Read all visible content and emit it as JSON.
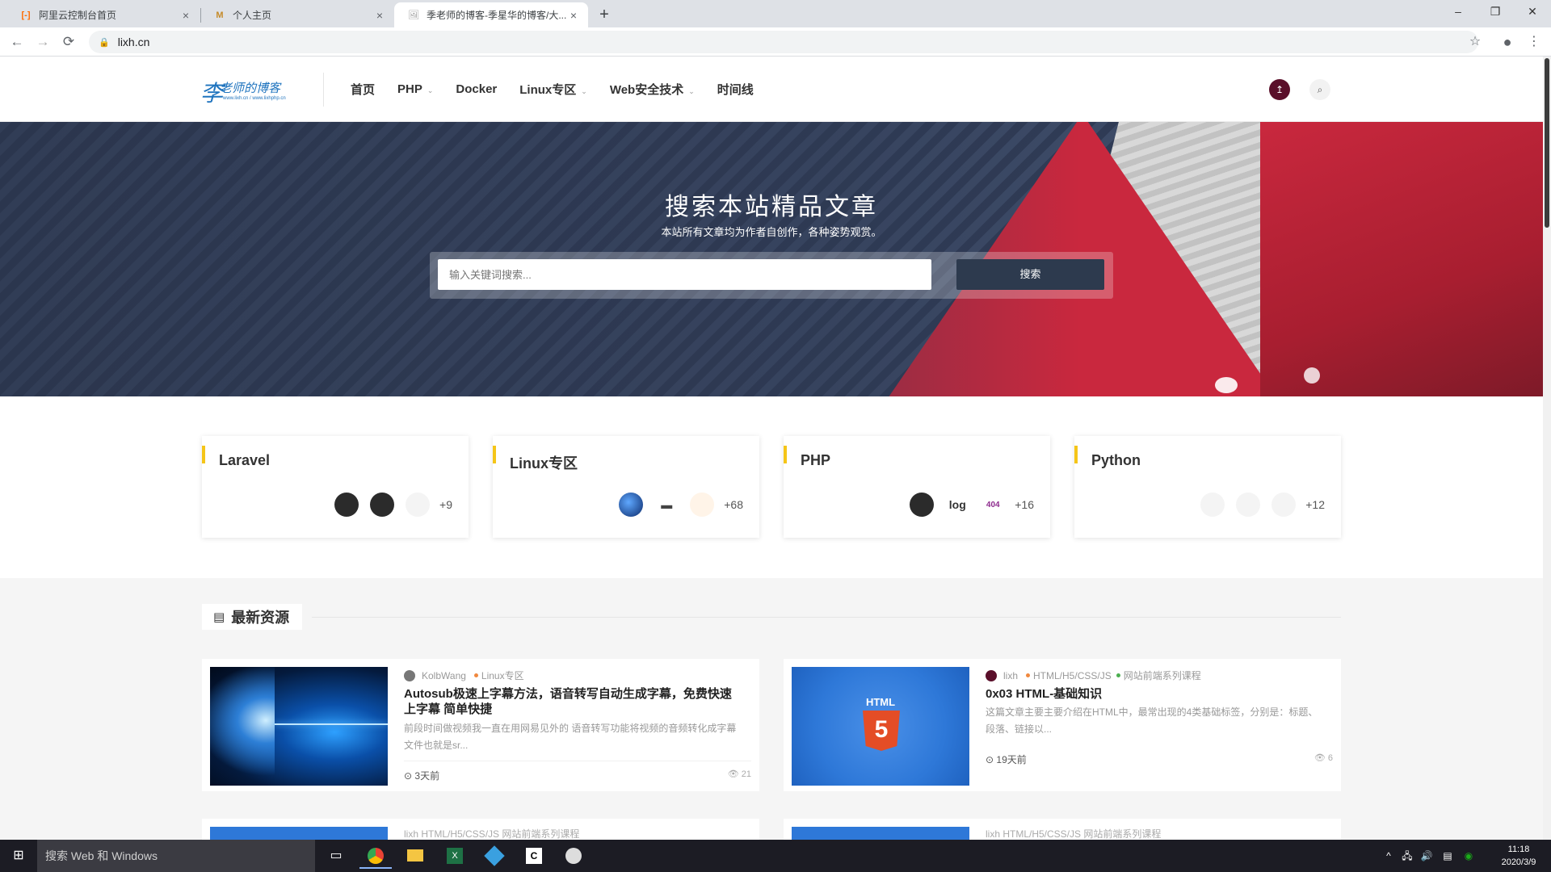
{
  "browser": {
    "tabs": [
      {
        "title": "阿里云控制台首页",
        "close": "×",
        "icon": "aliyun-icon"
      },
      {
        "title": "个人主页",
        "close": "×",
        "icon": "home-icon"
      },
      {
        "title": "季老师的博客-季星华的博客/大...",
        "close": "×",
        "icon": "blog-icon"
      }
    ],
    "new_tab": "+",
    "url": "lixh.cn",
    "window_controls": {
      "minimize": "–",
      "restore": "❐",
      "close": "✕"
    },
    "icons": {
      "back": "←",
      "forward": "→",
      "reload": "⟳",
      "lock": "🔒",
      "star": "☆",
      "account": "●",
      "menu": "⋮"
    }
  },
  "site": {
    "logo": {
      "mark": "李",
      "text": "老师的博客",
      "sub": "www.lixh.cn / www.lixhphp.cn"
    },
    "nav": [
      {
        "label": "首页",
        "caret": ""
      },
      {
        "label": "PHP",
        "caret": "⌄"
      },
      {
        "label": "Docker",
        "caret": ""
      },
      {
        "label": "Linux专区",
        "caret": "⌄"
      },
      {
        "label": "Web安全技术",
        "caret": "⌄"
      },
      {
        "label": "时间线",
        "caret": ""
      }
    ],
    "avatar_glyph": "↥",
    "search_glyph": "⌕"
  },
  "hero": {
    "title": "搜索本站精品文章",
    "subtitle": "本站所有文章均为作者自创作，各种姿势观赏。",
    "search_placeholder": "输入关键词搜索...",
    "search_button": "搜索"
  },
  "categories": [
    {
      "name": "Laravel",
      "count": "+9"
    },
    {
      "name": "Linux专区",
      "count": "+68"
    },
    {
      "name": "PHP",
      "count": "+16",
      "thumb_text": "log",
      "err_text": "404"
    },
    {
      "name": "Python",
      "count": "+12"
    }
  ],
  "latest": {
    "section_title": "最新资源",
    "posts": [
      {
        "author": "KolbWang",
        "category": "Linux专区",
        "title": "Autosub极速上字幕方法，语音转写自动生成字幕，免费快速上字幕 简单快捷",
        "excerpt": "前段时间做视频我一直在用网易见外的 语音转写功能将视频的音频转化成字幕文件也就是sr...",
        "time": "3天前",
        "views": "21",
        "cat_color": "#f0883e"
      },
      {
        "author": "lixh",
        "category": "HTML/H5/CSS/JS",
        "category2": "网站前端系列课程",
        "title": "0x03 HTML-基础知识",
        "excerpt": "这篇文章主要主要介绍在HTML中，最常出现的4类基础标签，分别是：标题、段落、链接以...",
        "time": "19天前",
        "views": "6",
        "image_word": "HTML",
        "image_badge": "5",
        "cat_color": "#f0883e",
        "cat2_color": "#4caf50"
      }
    ],
    "peek": [
      {
        "meta": "lixh   HTML/H5/CSS/JS   网站前端系列课程"
      },
      {
        "meta": "lixh   HTML/H5/CSS/JS   网站前端系列课程"
      }
    ]
  },
  "taskbar": {
    "search_placeholder": "搜索 Web 和 Windows",
    "time": "11:18",
    "date": "2020/3/9",
    "start_glyph": "⊞"
  }
}
